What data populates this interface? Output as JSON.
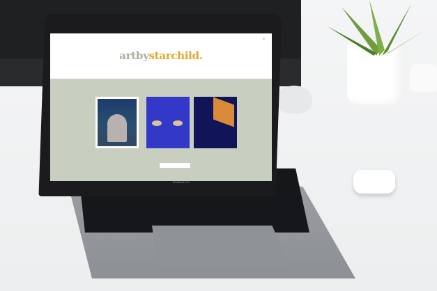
{
  "site": {
    "brand_part1": "artby",
    "brand_part2": "starchild.",
    "menu_icon": "menu-icon",
    "button_1": "",
    "button_2": "",
    "colors": {
      "brand_grey": "#aab0a0",
      "brand_gold": "#e2a72a",
      "gallery_bg": "#c8cfc0"
    }
  },
  "device": {
    "model_label": "MacBook Pro"
  },
  "artworks": [
    {
      "name": "ghost-in-forest-art"
    },
    {
      "name": "blue-eyes-art"
    },
    {
      "name": "night-interior-art"
    }
  ]
}
